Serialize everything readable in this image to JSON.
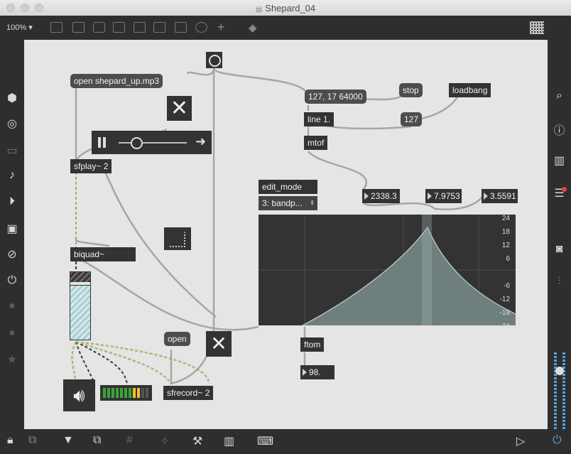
{
  "window": {
    "title": "Shepard_04"
  },
  "toolbar": {
    "zoom": "100%"
  },
  "patch": {
    "open_msg": "open shepard_up.mp3",
    "sfplay": "sfplay~ 2",
    "biquad": "biquad~",
    "list_msg": "127, 17 64000",
    "stop_msg": "stop",
    "loadbang": "loadbang",
    "line": "line 1.",
    "mtof": "mtof",
    "val127": "127",
    "edit_mode": "edit_mode",
    "menu_value": "3: bandp...",
    "freq": "2338.3",
    "gain": "7.9753",
    "q": "3.5591",
    "ftom": "ftom",
    "ftom_out": "98.",
    "open2": "open",
    "sfrecord": "sfrecord~ 2",
    "db_labels": [
      "24",
      "18",
      "12",
      "6",
      "-6",
      "-12",
      "-18",
      "-24"
    ]
  },
  "colors": {
    "canvas": "#e5e5e5",
    "object": "#333333",
    "wire": "#a6a6a6",
    "signal_wire": "#c8d26a",
    "accent": "#5aa0d8"
  }
}
